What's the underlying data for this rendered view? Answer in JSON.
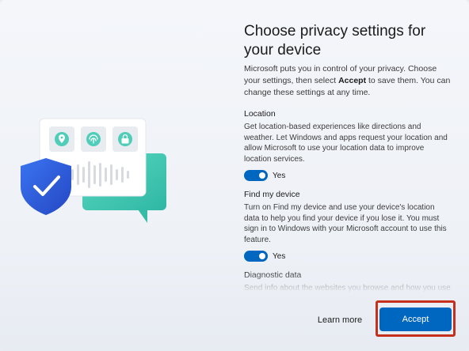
{
  "page": {
    "title": "Choose privacy settings for your device",
    "intro_before": "Microsoft puts you in control of your privacy. Choose your settings, then select ",
    "intro_bold": "Accept",
    "intro_after": " to save them. You can change these settings at any time."
  },
  "sections": [
    {
      "title": "Location",
      "description": "Get location-based experiences like directions and weather. Let Windows and apps request your location and allow Microsoft to use your location data to improve location services.",
      "toggle_label": "Yes",
      "toggle_on": true
    },
    {
      "title": "Find my device",
      "description": "Turn on Find my device and use your device's location data to help you find your device if you lose it. You must sign in to Windows with your Microsoft account to use this feature.",
      "toggle_label": "Yes",
      "toggle_on": true
    },
    {
      "title": "Diagnostic data",
      "description": "Send info about the websites you browse and how you use apps and features, plus additional info about device health, device activity, and enhanced error reporting."
    }
  ],
  "buttons": {
    "learn_more": "Learn more",
    "accept": "Accept"
  },
  "illustration": {
    "icons": [
      "location-pin-icon",
      "fingerprint-icon",
      "lock-icon",
      "shield-check-icon",
      "chat-bubble-icon",
      "soundwave-icon"
    ]
  },
  "colors": {
    "accent": "#0067c0",
    "highlight_border": "#c4301c",
    "shield_blue": "#2a5bd7",
    "teal": "#3cc3ae"
  }
}
